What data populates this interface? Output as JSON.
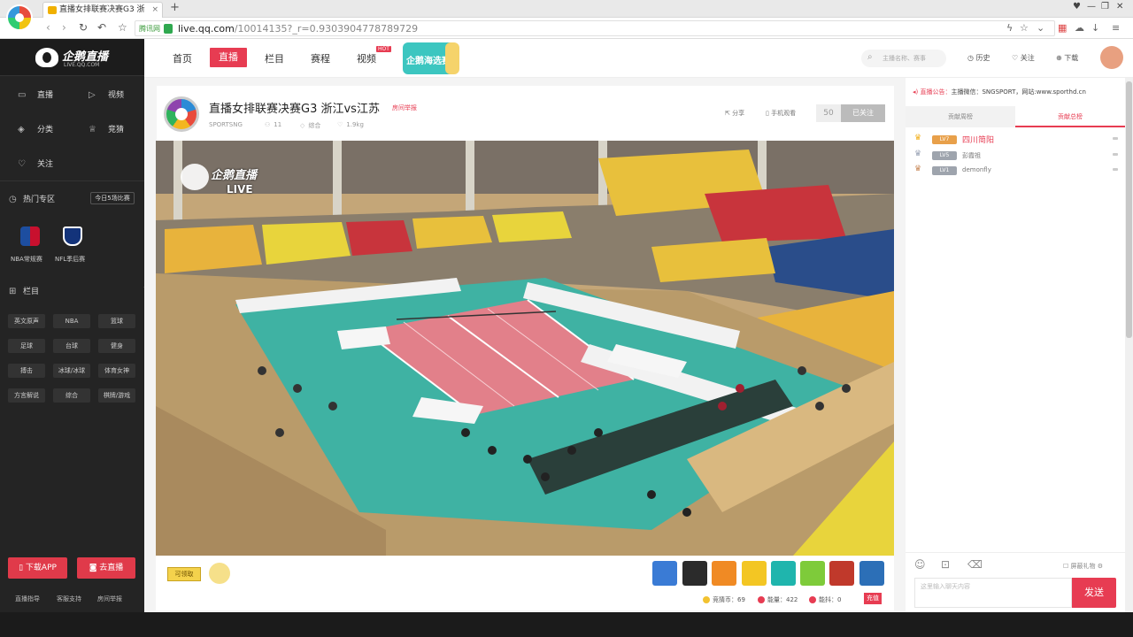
{
  "browser": {
    "tab_title": "直播女排联赛决赛G3 浙",
    "new_tab": "+",
    "secure_label": "腾讯网",
    "url_domain": "live.qq.com",
    "url_rest": "/10014135?_r=0.9303904778789729"
  },
  "sidebar": {
    "logo_text": "企鹅直播",
    "logo_sub": "LIVE.QQ.COM",
    "nav": [
      {
        "label": "直播",
        "icon": "tv-icon"
      },
      {
        "label": "视频",
        "icon": "play-icon"
      },
      {
        "label": "分类",
        "icon": "layers-icon"
      },
      {
        "label": "竞猜",
        "icon": "trophy-icon"
      },
      {
        "label": "关注",
        "icon": "heart-icon"
      }
    ],
    "hot_zone_label": "热门专区",
    "today_badge": "今日5场比赛",
    "hot_items": [
      {
        "label": "NBA常规赛"
      },
      {
        "label": "NFL季后赛"
      }
    ],
    "column_label": "栏目",
    "categories": [
      "英文原声",
      "NBA",
      "篮球",
      "足球",
      "台球",
      "健身",
      "搏击",
      "冰球/冰球",
      "体育女神",
      "方言解说",
      "综合",
      "棋牌/游戏"
    ],
    "download_app": "下载APP",
    "go_live": "去直播",
    "footer": [
      "直播指导",
      "客服支持",
      "房间举报"
    ]
  },
  "topnav": {
    "items": [
      "首页",
      "直播",
      "栏目",
      "赛程",
      "视频"
    ],
    "hot_badge": "HOT",
    "promo_text": "企鹅海选赛",
    "search_placeholder": "主播名称、赛事",
    "history": "历史",
    "follow": "关注",
    "download": "下载"
  },
  "room": {
    "title": "直播女排联赛决赛G3 浙江vs江苏",
    "report": "房间举报",
    "anchor": "SPORTSNG",
    "viewers": "11",
    "category": "综合",
    "likes": "1.9kg",
    "share": "分享",
    "mobile_watch": "手机观看",
    "fans_count": "50",
    "follow_btn": "已关注"
  },
  "video": {
    "watermark": "企鹅直播",
    "live_label": "LIVE"
  },
  "controls": {
    "redeem": "可领取",
    "gifts": [
      {
        "name": "gift-1",
        "color": "#3a7bd5"
      },
      {
        "name": "gift-2",
        "color": "#2b2b2b"
      },
      {
        "name": "gift-3",
        "color": "#f08a24"
      },
      {
        "name": "gift-4",
        "color": "#f3c623"
      },
      {
        "name": "gift-5",
        "color": "#1fb5ad"
      },
      {
        "name": "gift-6",
        "color": "#7ecb3a"
      },
      {
        "name": "gift-7",
        "color": "#c0392b"
      },
      {
        "name": "gift-8",
        "color": "#2c6fb7"
      }
    ],
    "coins": "竞猜币：69",
    "coupons": "能量：422",
    "tickets": "能抖：0",
    "charge": "充值"
  },
  "chat": {
    "notice_prefix": "直播公告：",
    "notice_text": "主播微信：SNGSPORT，网站:www.sporthd.cn",
    "tab_week": "贡献周榜",
    "tab_total": "贡献总榜",
    "ranks": [
      {
        "level": "LV7",
        "name": "四川简阳",
        "color": "#e8a04a"
      },
      {
        "level": "LV5",
        "name": "彭霞祖",
        "color": "#9ea4ad"
      },
      {
        "level": "LV1",
        "name": "demonfly",
        "color": "#9ea4ad"
      }
    ],
    "shield_label": "屏蔽礼物",
    "input_placeholder": "这里输入聊天内容",
    "send": "发送"
  }
}
